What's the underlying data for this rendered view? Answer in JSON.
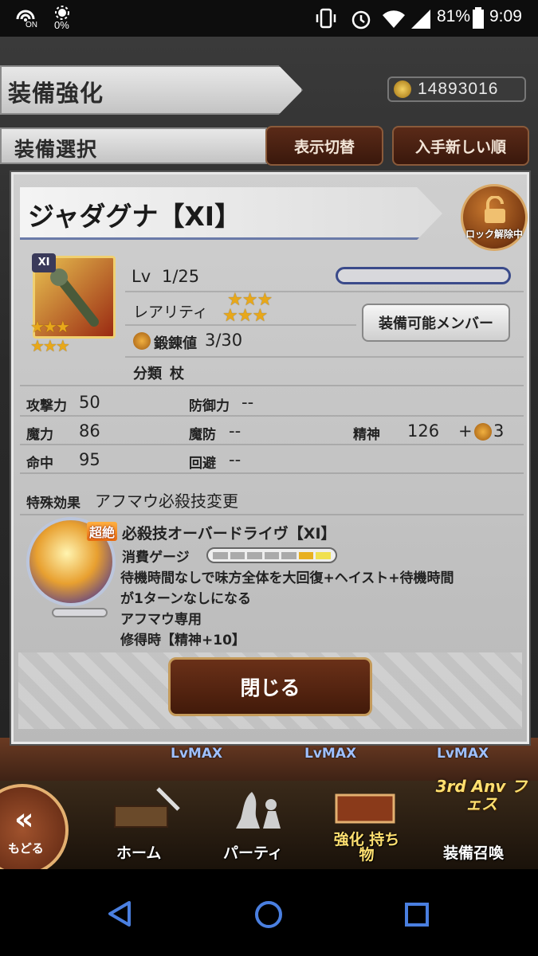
{
  "status_bar": {
    "left_icon_badge": "ON",
    "data_percent": "0%",
    "battery": "81%",
    "time": "9:09"
  },
  "header": {
    "title": "装備強化",
    "currency_value": "14893016",
    "section_title": "装備選択",
    "toggle_display_label": "表示切替",
    "sort_label": "入手新しい順"
  },
  "modal": {
    "item_name": "ジャダグナ【XI】",
    "lock_label": "ロック解除中",
    "item_badge": "XI",
    "level_label": "Lv",
    "level_value": "1/25",
    "level_progress": 0.0,
    "rarity_label": "レアリティ",
    "rarity_stars": 6,
    "forge_label": "鍛錬値",
    "forge_value": "3/30",
    "category_label": "分類",
    "category_value": "杖",
    "equip_members_button": "装備可能メンバー",
    "stats": {
      "atk_label": "攻撃力",
      "atk_value": "50",
      "def_label": "防御力",
      "def_value": "--",
      "mag_label": "魔力",
      "mag_value": "86",
      "mdef_label": "魔防",
      "mdef_value": "--",
      "spr_label": "精神",
      "spr_value": "126",
      "spr_bonus": "+",
      "spr_bonus_value": "3",
      "acc_label": "命中",
      "acc_value": "95",
      "eva_label": "回避",
      "eva_value": "--"
    },
    "special_effect_label": "特殊効果",
    "special_effect_value": "アフマウ必殺技変更",
    "ability": {
      "tag": "超絶",
      "name": "必殺技オーバードライヴ【XI】",
      "gauge_label": "消費ゲージ",
      "gauge_segments_filled": 2,
      "gauge_segments_total": 7,
      "desc_line1": "待機時間なしで味方全体を大回復+ヘイスト+待機時間",
      "desc_line2": "が1ターンなしになる",
      "desc_line3": "アフマウ専用",
      "desc_line4": "修得時【精神+10】"
    },
    "close_button": "閉じる"
  },
  "bottom_nav": {
    "back_label": "もどる",
    "home_label": "ホーム",
    "party_label": "パーティ",
    "items_label": "強化 持ち物",
    "summon_label": "装備召喚",
    "event_badge": "3rd Anv フェス",
    "lvmax_1": "LvMAX",
    "lvmax_2": "LvMAX",
    "lvmax_3": "LvMAX"
  },
  "colors": {
    "accent_gold": "#e8a81a",
    "button_brown": "#5a2a18",
    "gauge_blue": "#3a4a8a",
    "ability_orange": "#e86a10"
  }
}
